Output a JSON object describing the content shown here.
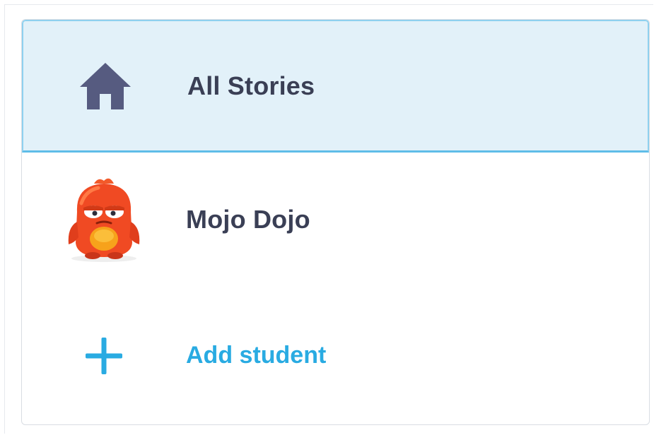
{
  "sidebar": {
    "items": [
      {
        "label": "All Stories",
        "icon": "home-icon",
        "selected": true
      },
      {
        "label": "Mojo Dojo",
        "icon": "monster-avatar-icon",
        "selected": false
      },
      {
        "label": "Add student",
        "icon": "plus-icon",
        "selected": false
      }
    ]
  },
  "colors": {
    "selected_background": "#e2f1f9",
    "selected_border": "#5fbde8",
    "text_primary": "#3a3f55",
    "accent": "#29abe2",
    "home_icon": "#565b80",
    "avatar_body": "#f04a23"
  }
}
